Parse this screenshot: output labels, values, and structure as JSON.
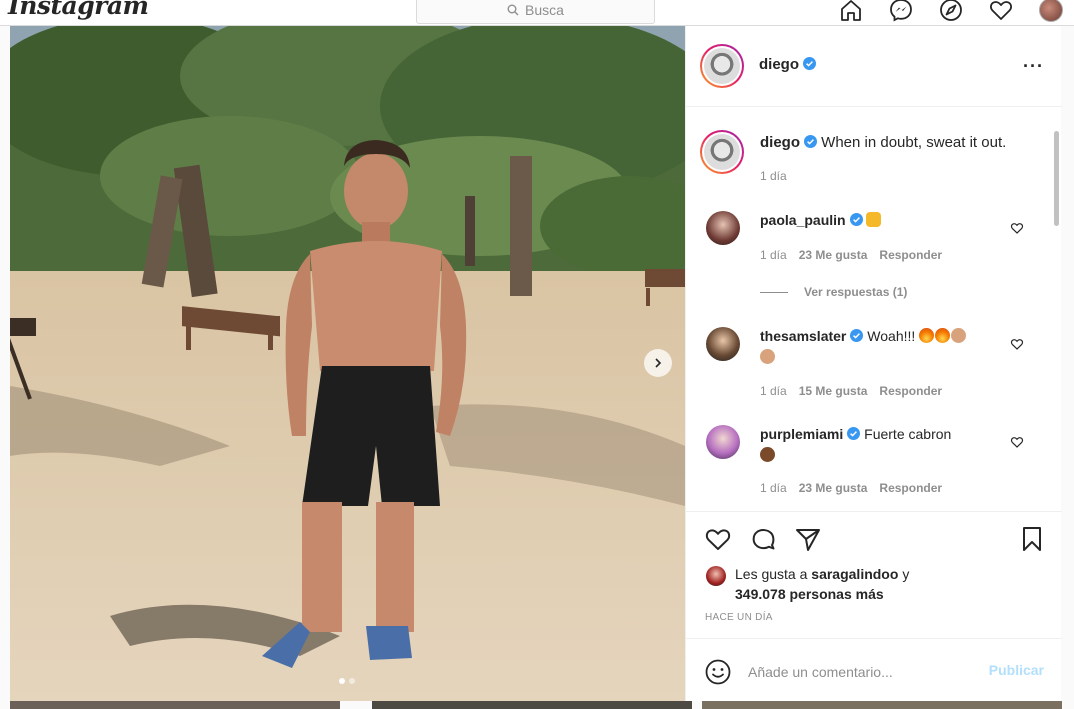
{
  "app": {
    "logo": "Instagram",
    "search_placeholder": "Busca"
  },
  "nav": {
    "icons": [
      "home-icon",
      "messenger-icon",
      "explore-icon",
      "heart-icon",
      "profile-avatar"
    ]
  },
  "post": {
    "author": "diego",
    "carousel_dots": 2,
    "active_dot": 0
  },
  "caption": {
    "username": "diego",
    "text": "When in doubt, sweat it out.",
    "time": "1 día"
  },
  "comments": [
    {
      "username": "paola_paulin",
      "verified": true,
      "text": "",
      "emoji": [
        "raising-hands"
      ],
      "time": "1 día",
      "likes": "23 Me gusta",
      "reply_label": "Responder",
      "view_replies": "Ver respuestas (1)"
    },
    {
      "username": "thesamslater",
      "verified": true,
      "text": "Woah!!!",
      "emoji": [
        "fire",
        "fire",
        "flexed-biceps",
        "flexed-biceps"
      ],
      "time": "1 día",
      "likes": "15 Me gusta",
      "reply_label": "Responder"
    },
    {
      "username": "purplemiami",
      "verified": true,
      "text": "Fuerte cabron",
      "emoji": [
        "flexed-biceps"
      ],
      "time": "1 día",
      "likes": "23 Me gusta",
      "reply_label": "Responder"
    }
  ],
  "likes": {
    "prefix": "Les gusta a",
    "user": "saragalindoo",
    "conj": "y",
    "others": "349.078 personas más"
  },
  "timeago": "HACE UN DÍA",
  "add_comment": {
    "placeholder": "Añade un comentario...",
    "publish_label": "Publicar"
  },
  "colors": {
    "verified": "#3897f0",
    "publish_disabled": "#b2dffc",
    "secondary_text": "#8e8e8e"
  }
}
